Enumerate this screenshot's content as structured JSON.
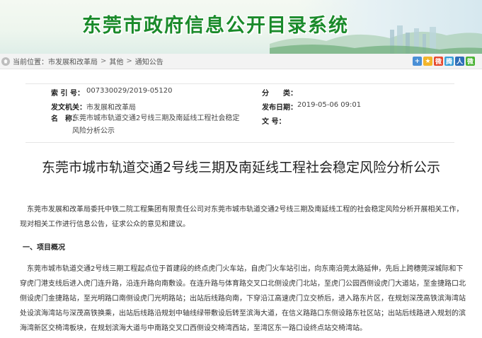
{
  "banner": {
    "title": "东莞市政府信息公开目录系统"
  },
  "breadcrumb": {
    "prefix": "当前位置：",
    "items": [
      "市发展和改革局",
      "其他",
      "通知公告"
    ],
    "separator": ">"
  },
  "share": {
    "icons": [
      {
        "name": "add-icon",
        "color": "#4a8fd6",
        "glyph": "+"
      },
      {
        "name": "qzone-icon",
        "color": "#f3b52a",
        "glyph": "★"
      },
      {
        "name": "weibo-icon",
        "color": "#e64a2e",
        "glyph": "微"
      },
      {
        "name": "tencent-weibo-icon",
        "color": "#3aa0d8",
        "glyph": "腾"
      },
      {
        "name": "renren-icon",
        "color": "#2f6fb8",
        "glyph": "人"
      },
      {
        "name": "wechat-icon",
        "color": "#49b233",
        "glyph": "微"
      }
    ]
  },
  "meta": {
    "index_label": "索 引 号：",
    "index_value": "007330029/2019-05120",
    "category_label": "分　　类：",
    "category_value": "",
    "org_label": "发文机关：",
    "org_value": "市发展和改革局",
    "date_label": "发布日期：",
    "date_value": "2019-05-06 09:01",
    "name_label": "名　称：",
    "name_value": "东莞市城市轨道交通2号线三期及南延线工程社会稳定风险分析公示",
    "docno_label": "文 号：",
    "docno_value": ""
  },
  "article": {
    "title": "东莞市城市轨道交通2号线三期及南延线工程社会稳定风险分析公示",
    "intro": "东莞市发展和改革局委托中铁二院工程集团有限责任公司对东莞市城市轨道交通2号线三期及南延线工程的社会稳定风险分析开展相关工作，现对相关工作进行信息公告，征求公众的意见和建议。",
    "section1": "一、项目概况",
    "body1": "东莞市城市轨道交通2号线三期工程起点位于首建段的终点虎门火车站，自虎门火车站引出，向东南沿莞太路延伸，先后上跨穗莞深城际和下穿虎门港支线后进入虎门连升路，沿连升路向南敷设。在连升路与体育路交叉口北侧设虎门北站，至虎门公园西侧设虎门大道站，至金捷路口北侧设虎门金捷路站，至光明路口南侧设虎门光明路站；出站后线路向南，下穿沿江高速虎门立交桥后，进入路东片区，在规划深茂高铁滨海湾站处设滨海湾站与深茂高铁换乘，出站后线路沿规划中轴线绿带敷设后转至滨海大道，在信义路路口东侧设路东社区站；出站后线路进入规划的滨海湾新区交椅湾板块，在规划滨海大道与中南路交叉口西侧设交椅湾西站，至湾区东一路口设终点站交椅湾站。"
  }
}
